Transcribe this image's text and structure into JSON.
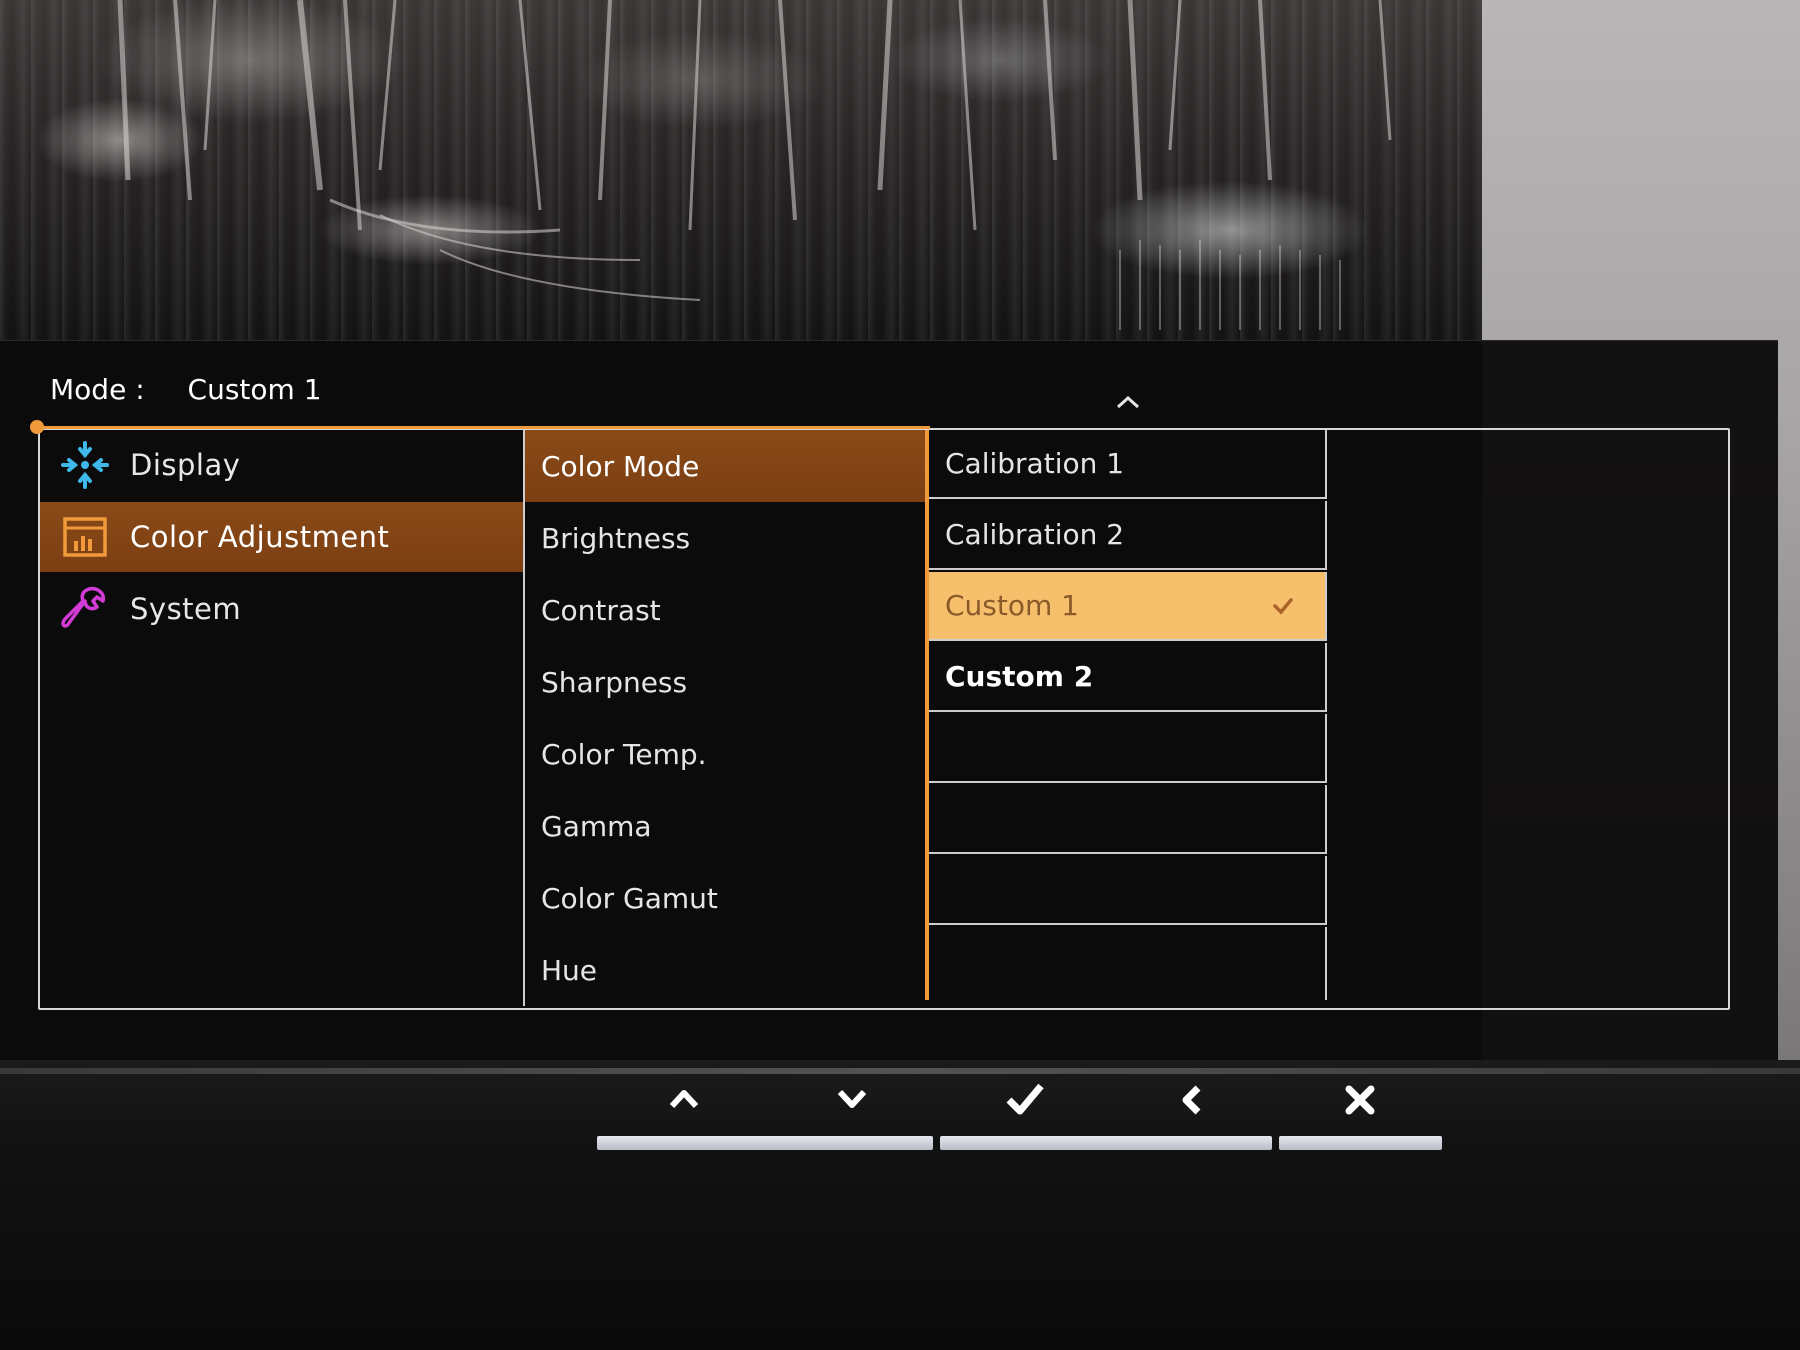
{
  "osd": {
    "mode_label": "Mode :",
    "mode_value": "Custom 1"
  },
  "main_menu": {
    "items": [
      {
        "label": "Display",
        "icon": "display-icon"
      },
      {
        "label": "Color Adjustment",
        "icon": "color-adjustment-icon",
        "selected": true
      },
      {
        "label": "System",
        "icon": "wrench-icon"
      }
    ]
  },
  "sub_menu": {
    "items": [
      {
        "label": "Color Mode",
        "selected": true
      },
      {
        "label": "Brightness"
      },
      {
        "label": "Contrast"
      },
      {
        "label": "Sharpness"
      },
      {
        "label": "Color Temp."
      },
      {
        "label": "Gamma"
      },
      {
        "label": "Color Gamut"
      },
      {
        "label": "Hue"
      }
    ]
  },
  "options": {
    "items": [
      {
        "label": "Calibration 1"
      },
      {
        "label": "Calibration 2"
      },
      {
        "label": "Custom 1",
        "selected": true,
        "checked": true
      },
      {
        "label": "Custom 2"
      },
      {
        "label": ""
      },
      {
        "label": ""
      },
      {
        "label": ""
      },
      {
        "label": ""
      }
    ]
  },
  "hardware_buttons": [
    "up-icon",
    "down-icon",
    "confirm-check-icon",
    "back-icon",
    "close-icon"
  ],
  "colors": {
    "accent_orange": "#f19a3c",
    "selected_bg": "#7c3f12",
    "option_selected_bg": "#f6bf6c",
    "display_icon": "#3fb8ea",
    "color_adjustment_icon": "#f19a3c",
    "system_icon": "#d23bd6"
  }
}
